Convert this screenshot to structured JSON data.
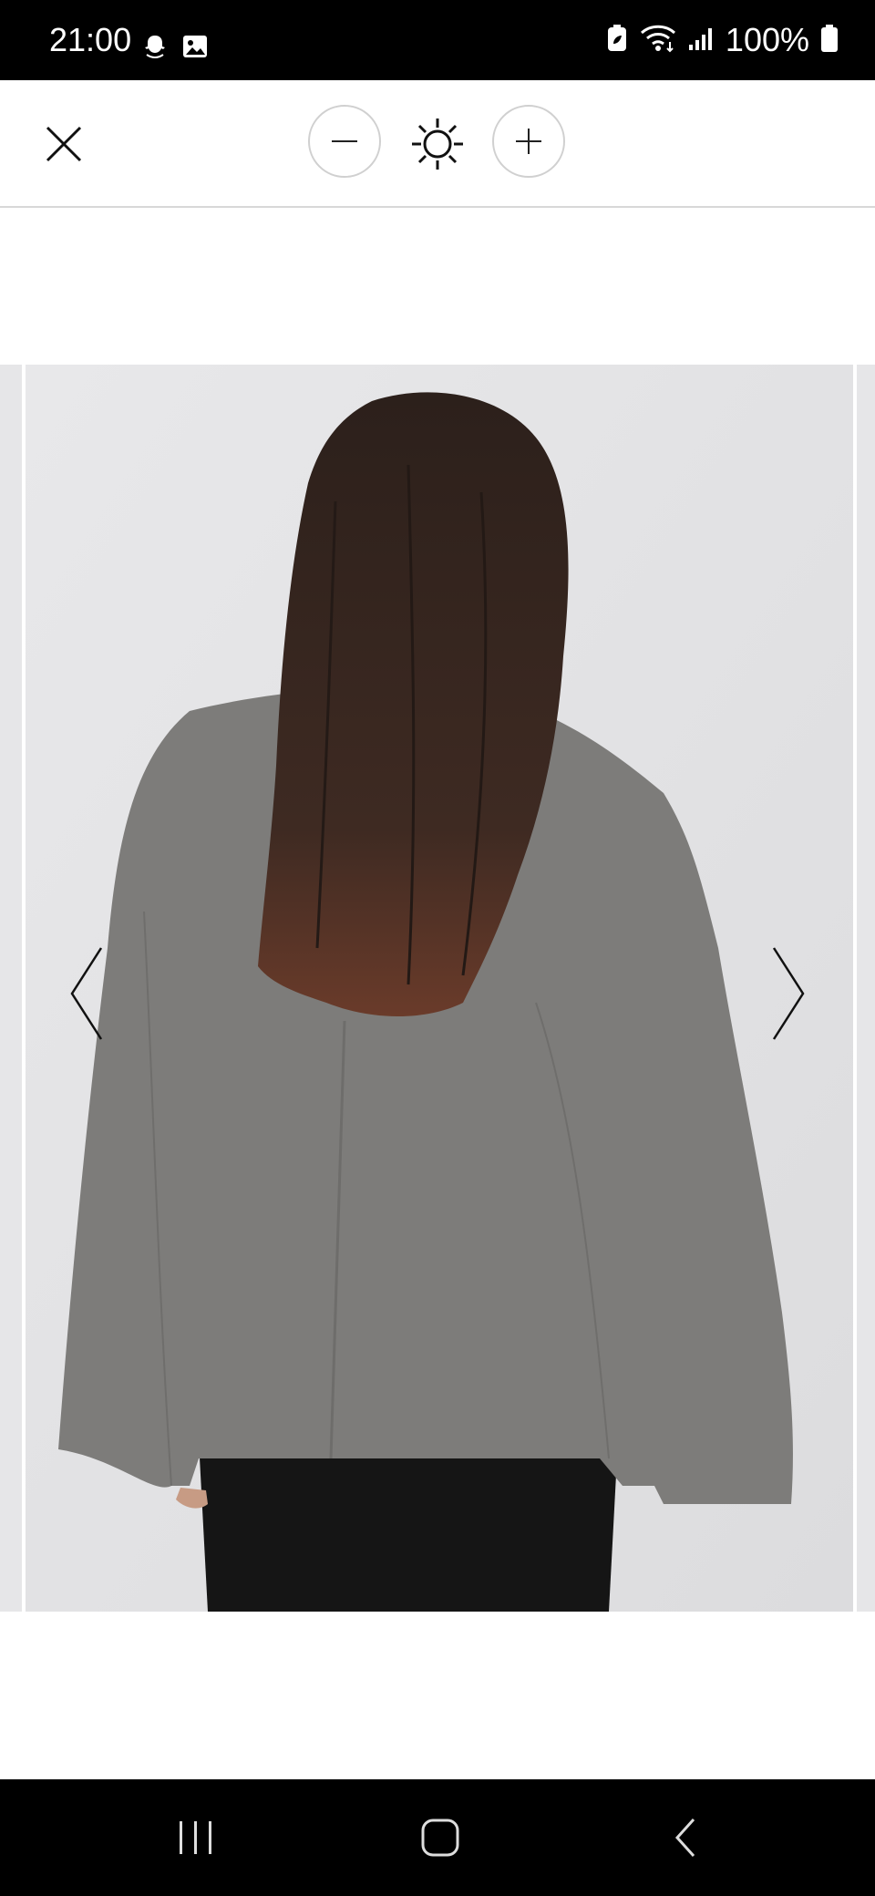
{
  "status_bar": {
    "time": "21:00",
    "battery_text": "100%",
    "left_icons": [
      "snapchat-icon",
      "gallery-icon"
    ],
    "right_icons": [
      "battery-saver-icon",
      "wifi-icon",
      "signal-icon",
      "battery-icon"
    ]
  },
  "toolbar": {
    "icons": [
      "close-icon",
      "minus-icon",
      "brightness-icon",
      "plus-icon"
    ]
  },
  "viewer": {
    "image_description_icon": "product-photo",
    "prev_icon": "chevron-left-icon",
    "next_icon": "chevron-right-icon"
  },
  "nav_bar": {
    "icons": [
      "recent-apps-icon",
      "home-icon",
      "back-icon"
    ]
  },
  "colors": {
    "status_bg": "#000000",
    "toolbar_bg": "#ffffff",
    "photo_bg": "#e7e7e9",
    "coat": "#7d7c7a",
    "hair": "#3a2a22"
  }
}
